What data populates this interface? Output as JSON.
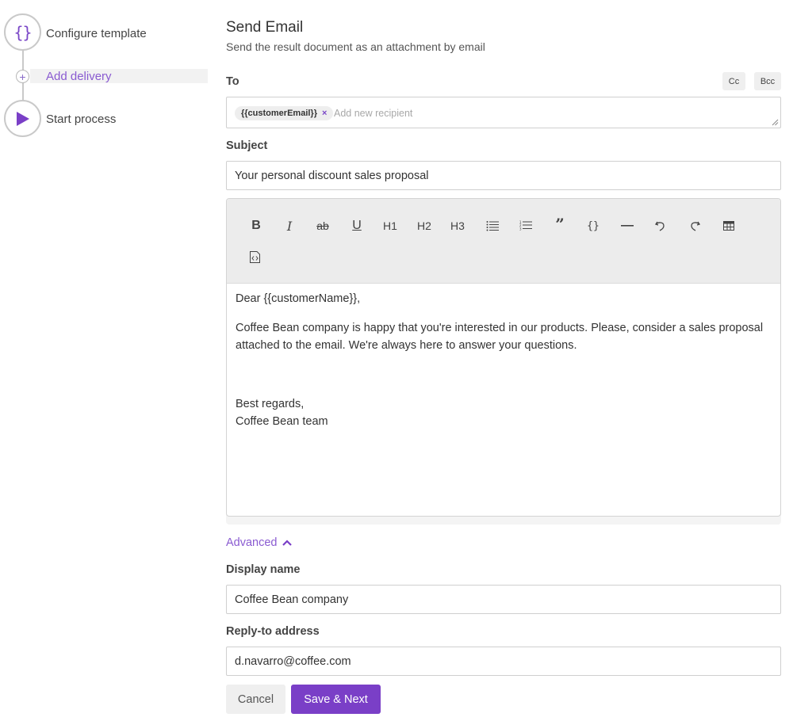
{
  "stepper": {
    "steps": [
      {
        "label": "Configure template",
        "icon": "curly-braces-icon"
      },
      {
        "label": "Add delivery",
        "icon": "plus-circle-icon"
      },
      {
        "label": "Start process",
        "icon": "play-icon"
      }
    ]
  },
  "form": {
    "title": "Send Email",
    "subtitle": "Send the result document as an attachment by email",
    "to": {
      "label": "To",
      "cc_label": "Cc",
      "bcc_label": "Bcc",
      "chip": "{{customerEmail}}",
      "placeholder": "Add new recipient"
    },
    "subject": {
      "label": "Subject",
      "value": "Your personal discount sales proposal"
    },
    "editor": {
      "toolbar": {
        "h1": "H1",
        "h2": "H2",
        "h3": "H3"
      },
      "body": {
        "greeting": "Dear {{customerName}},",
        "paragraph": "Coffee Bean company is happy that you're interested in our products. Please, consider a sales proposal attached to the email.  We're always here to answer your questions.",
        "closing1": "Best regards,",
        "closing2": "Coffee Bean team"
      }
    },
    "advanced_label": "Advanced",
    "display_name": {
      "label": "Display name",
      "value": "Coffee Bean company"
    },
    "reply_to": {
      "label": "Reply-to address",
      "value": "d.navarro@coffee.com"
    },
    "buttons": {
      "cancel": "Cancel",
      "save_next": "Save & Next"
    }
  },
  "colors": {
    "accent": "#7a3fc7",
    "accent_text": "#8a5bd1",
    "toolbar_bg": "#ececec",
    "border": "#cfcfcf"
  }
}
